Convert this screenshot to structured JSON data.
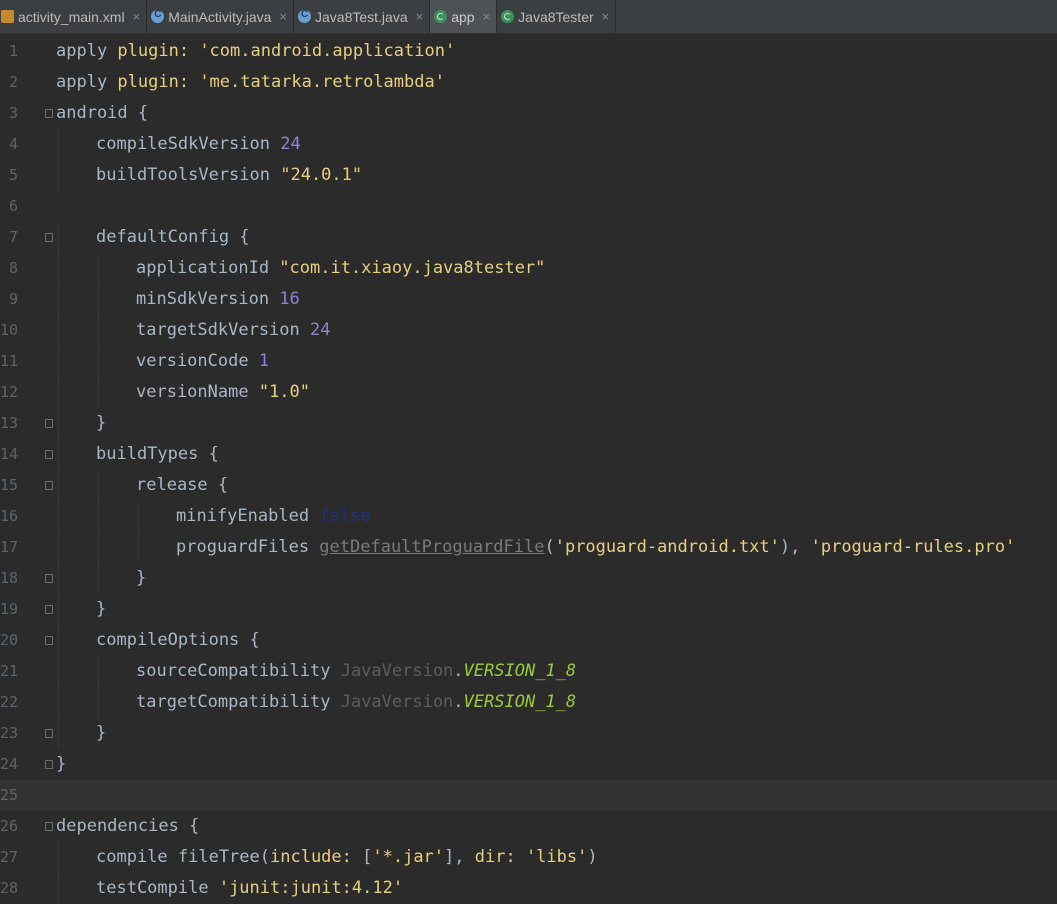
{
  "tabs": [
    {
      "label": "activity_main.xml",
      "icon": "xml-file-icon",
      "active": false
    },
    {
      "label": "MainActivity.java",
      "icon": "java-class-icon",
      "active": false
    },
    {
      "label": "Java8Test.java",
      "icon": "java-class-icon",
      "active": false
    },
    {
      "label": "app",
      "icon": "gradle-icon",
      "active": true
    },
    {
      "label": "Java8Tester",
      "icon": "gradle-icon",
      "active": false
    }
  ],
  "close_glyph": "×",
  "lines": [
    {
      "n": "1",
      "indent": 0,
      "fold": false,
      "segs": [
        [
          "def",
          "apply "
        ],
        [
          "plg",
          "plugin: "
        ],
        [
          "str",
          "'com.android.application'"
        ]
      ]
    },
    {
      "n": "2",
      "indent": 0,
      "fold": false,
      "segs": [
        [
          "def",
          "apply "
        ],
        [
          "plg",
          "plugin: "
        ],
        [
          "str",
          "'me.tatarka.retrolambda'"
        ]
      ]
    },
    {
      "n": "3",
      "indent": 0,
      "fold": true,
      "segs": [
        [
          "def",
          "android {"
        ]
      ]
    },
    {
      "n": "4",
      "indent": 1,
      "fold": false,
      "segs": [
        [
          "def",
          "compileSdkVersion "
        ],
        [
          "num",
          "24"
        ]
      ]
    },
    {
      "n": "5",
      "indent": 1,
      "fold": false,
      "segs": [
        [
          "def",
          "buildToolsVersion "
        ],
        [
          "str",
          "\"24.0.1\""
        ]
      ]
    },
    {
      "n": "6",
      "indent": 0,
      "fold": false,
      "segs": []
    },
    {
      "n": "7",
      "indent": 1,
      "fold": true,
      "segs": [
        [
          "def",
          "defaultConfig {"
        ]
      ]
    },
    {
      "n": "8",
      "indent": 2,
      "fold": false,
      "segs": [
        [
          "def",
          "applicationId "
        ],
        [
          "str",
          "\"com.it.xiaoy.java8tester\""
        ]
      ]
    },
    {
      "n": "9",
      "indent": 2,
      "fold": false,
      "segs": [
        [
          "def",
          "minSdkVersion "
        ],
        [
          "num",
          "16"
        ]
      ]
    },
    {
      "n": "10",
      "indent": 2,
      "fold": false,
      "segs": [
        [
          "def",
          "targetSdkVersion "
        ],
        [
          "num",
          "24"
        ]
      ]
    },
    {
      "n": "11",
      "indent": 2,
      "fold": false,
      "segs": [
        [
          "def",
          "versionCode "
        ],
        [
          "num",
          "1"
        ]
      ]
    },
    {
      "n": "12",
      "indent": 2,
      "fold": false,
      "segs": [
        [
          "def",
          "versionName "
        ],
        [
          "str",
          "\"1.0\""
        ]
      ]
    },
    {
      "n": "13",
      "indent": 1,
      "fold": true,
      "segs": [
        [
          "def",
          "}"
        ]
      ]
    },
    {
      "n": "14",
      "indent": 1,
      "fold": true,
      "segs": [
        [
          "def",
          "buildTypes {"
        ]
      ]
    },
    {
      "n": "15",
      "indent": 2,
      "fold": true,
      "segs": [
        [
          "def",
          "release {"
        ]
      ]
    },
    {
      "n": "16",
      "indent": 3,
      "fold": false,
      "segs": [
        [
          "def",
          "minifyEnabled "
        ],
        [
          "fals",
          "false"
        ]
      ]
    },
    {
      "n": "17",
      "indent": 3,
      "fold": false,
      "segs": [
        [
          "def",
          "proguardFiles "
        ],
        [
          "under",
          "getDefaultProguardFile"
        ],
        [
          "def",
          "("
        ],
        [
          "str",
          "'proguard-android.txt'"
        ],
        [
          "def",
          "), "
        ],
        [
          "str",
          "'proguard-rules.pro'"
        ]
      ]
    },
    {
      "n": "18",
      "indent": 2,
      "fold": true,
      "segs": [
        [
          "def",
          "}"
        ]
      ]
    },
    {
      "n": "19",
      "indent": 1,
      "fold": true,
      "segs": [
        [
          "def",
          "}"
        ]
      ]
    },
    {
      "n": "20",
      "indent": 1,
      "fold": true,
      "segs": [
        [
          "def",
          "compileOptions {"
        ]
      ]
    },
    {
      "n": "21",
      "indent": 2,
      "fold": false,
      "segs": [
        [
          "def",
          "sourceCompatibility "
        ],
        [
          "gray",
          "JavaVersion"
        ],
        [
          "def",
          "."
        ],
        [
          "ital",
          "VERSION_1_8"
        ]
      ]
    },
    {
      "n": "22",
      "indent": 2,
      "fold": false,
      "segs": [
        [
          "def",
          "targetCompatibility "
        ],
        [
          "gray",
          "JavaVersion"
        ],
        [
          "def",
          "."
        ],
        [
          "ital",
          "VERSION_1_8"
        ]
      ]
    },
    {
      "n": "23",
      "indent": 1,
      "fold": true,
      "segs": [
        [
          "def",
          "}"
        ]
      ]
    },
    {
      "n": "24",
      "indent": 0,
      "fold": true,
      "segs": [
        [
          "def",
          "}"
        ]
      ]
    },
    {
      "n": "25",
      "indent": 0,
      "fold": false,
      "current": true,
      "segs": []
    },
    {
      "n": "26",
      "indent": 0,
      "fold": true,
      "segs": [
        [
          "def",
          "dependencies {"
        ]
      ]
    },
    {
      "n": "27",
      "indent": 1,
      "fold": false,
      "segs": [
        [
          "def",
          "compile fileTree("
        ],
        [
          "plg",
          "include: "
        ],
        [
          "def",
          "["
        ],
        [
          "str",
          "'*.jar'"
        ],
        [
          "def",
          "], "
        ],
        [
          "plg",
          "dir: "
        ],
        [
          "str",
          "'libs'"
        ],
        [
          "def",
          ")"
        ]
      ]
    },
    {
      "n": "28",
      "indent": 1,
      "fold": false,
      "segs": [
        [
          "def",
          "testCompile "
        ],
        [
          "str",
          "'junit:junit:4.12'"
        ]
      ]
    }
  ]
}
